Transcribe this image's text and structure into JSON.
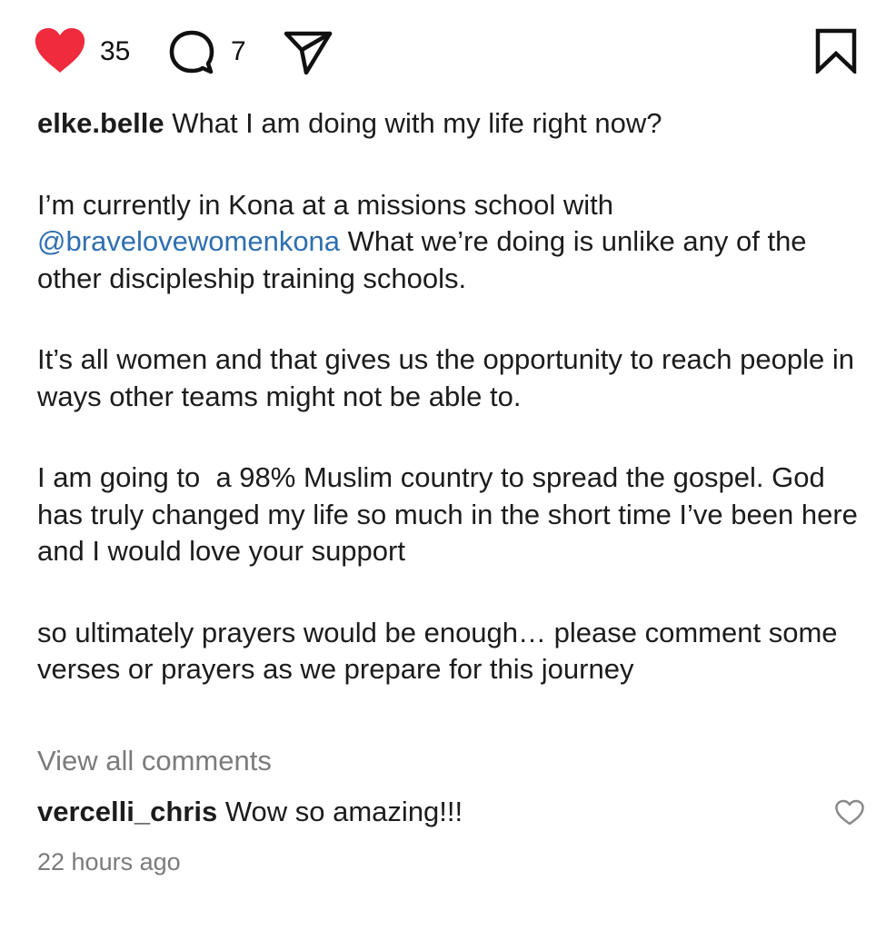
{
  "actions": {
    "like_count": "35",
    "comment_count": "7",
    "like_color": "#ef2b3d",
    "icons": {
      "like": "heart-filled-icon",
      "comment": "comment-bubble-icon",
      "share": "paper-plane-icon",
      "save": "bookmark-icon"
    }
  },
  "caption": {
    "username": "elke.belle",
    "first_line": "What I am doing with my life right now?",
    "para2_before": "I’m currently in Kona at a missions school with ",
    "mention": "@bravelovewomenkona",
    "para2_after": " What we’re doing is unlike any of the other discipleship training schools.",
    "para3": "It’s all women and that gives us the opportunity to reach people in ways other teams might not be able to.",
    "para4": "I am going to  a 98% Muslim country to spread the gospel. God has truly changed my life so much in the short time I’ve been here and I would love your support",
    "para5": "so ultimately prayers would be enough… please comment some verses or prayers as we prepare for this journey"
  },
  "comments": {
    "view_all": "View all comments",
    "top_comment": {
      "username": "vercelli_chris",
      "text": "Wow so amazing!!!"
    }
  },
  "timestamp": "22 hours ago"
}
